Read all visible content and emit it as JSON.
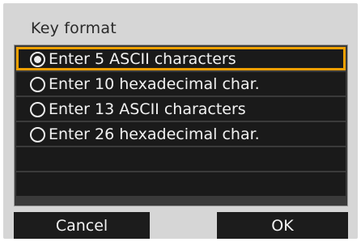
{
  "dialog": {
    "title": "Key format",
    "options": [
      {
        "label": "Enter 5 ASCII characters",
        "selected": true
      },
      {
        "label": "Enter 10 hexadecimal char.",
        "selected": false
      },
      {
        "label": "Enter 13 ASCII characters",
        "selected": false
      },
      {
        "label": "Enter 26 hexadecimal char.",
        "selected": false
      }
    ],
    "buttons": {
      "cancel_label": "Cancel",
      "ok_label": "OK"
    }
  },
  "colors": {
    "panel_background": "#d6d6d6",
    "list_background": "#1a1a1a",
    "selection_border": "#f0a000",
    "text_light": "#f2f2f2"
  }
}
